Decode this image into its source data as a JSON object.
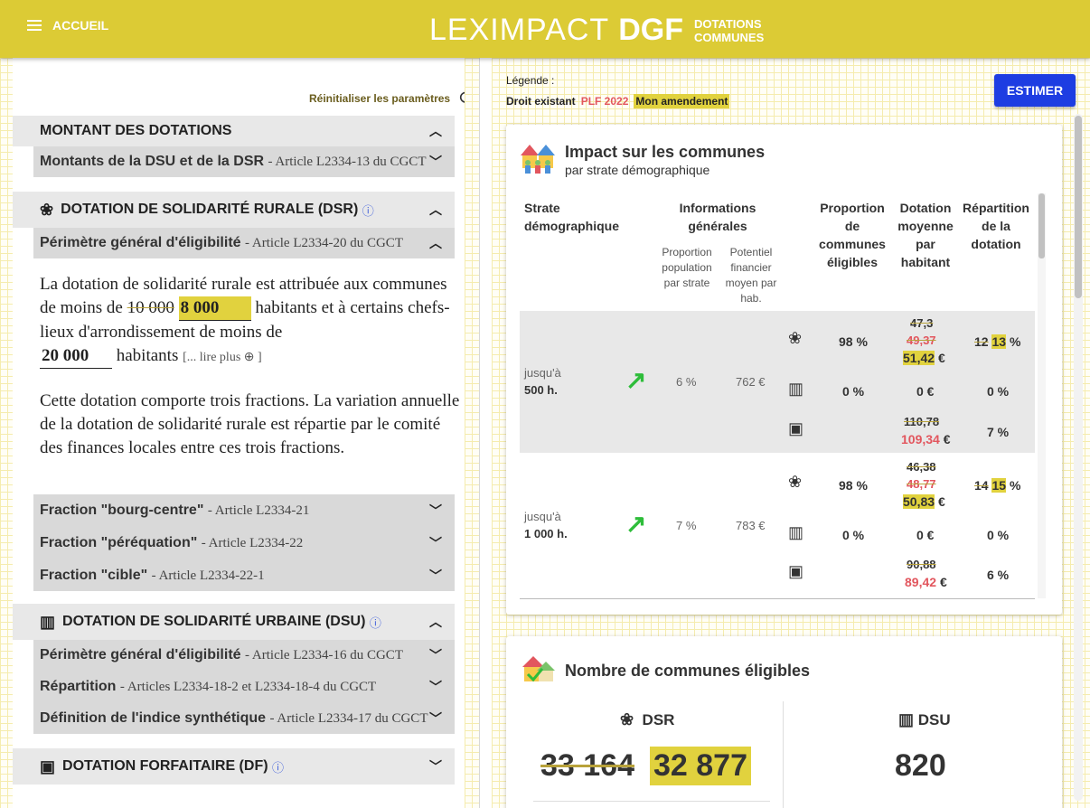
{
  "header": {
    "menu_label": "ACCUEIL",
    "logo_light": "LEXIMPACT",
    "logo_bold": "DGF",
    "logo_sub1": "DOTATIONS",
    "logo_sub2": "COMMUNES"
  },
  "left": {
    "reset_label": "Réinitialiser les paramètres",
    "sections": {
      "montant": {
        "title": "MONTANT DES DOTATIONS",
        "sub_title": "Montants de la DSU et de la DSR",
        "sub_article": "- Article L2334-13 du CGCT"
      },
      "dsr": {
        "title": "DOTATION DE SOLIDARITÉ RURALE (DSR)",
        "perimetre": "Périmètre général d'éligibilité",
        "perimetre_article": "- Article L2334-20 du CGCT",
        "p1_a": "La dotation de solidarité rurale est attribuée aux communes de moins de",
        "p1_old": "10 000",
        "p1_new": "8 000",
        "p1_b": "habitants et à certains chefs-lieux d'arrondissement de moins de",
        "p1_val2": "20 000",
        "p1_c": "habitants",
        "read_more": "[... lire plus ⊕ ]",
        "p2": "Cette dotation comporte trois fractions. La variation annuelle de la dotation de solidarité rurale est répartie par le comité des finances locales entre ces trois fractions.",
        "fractions": [
          {
            "label": "Fraction \"bourg-centre\"",
            "article": "- Article L2334-21"
          },
          {
            "label": "Fraction \"péréquation\"",
            "article": "- Article L2334-22"
          },
          {
            "label": "Fraction \"cible\"",
            "article": "- Article L2334-22-1"
          }
        ]
      },
      "dsu": {
        "title": "DOTATION DE SOLIDARITÉ URBAINE (DSU)",
        "items": [
          {
            "label": "Périmètre général d'éligibilité",
            "article": "- Article L2334-16 du CGCT"
          },
          {
            "label": "Répartition",
            "article": "- Articles L2334-18-2 et L2334-18-4 du CGCT"
          },
          {
            "label": "Définition de l'indice synthétique",
            "article": "- Article L2334-17 du CGCT"
          }
        ]
      },
      "df": {
        "title": "DOTATION FORFAITAIRE (DF)"
      }
    }
  },
  "right": {
    "legend": {
      "title": "Légende :",
      "droit": "Droit existant",
      "plf": "PLF 2022",
      "amendement": "Mon amendement"
    },
    "estimer_label": "ESTIMER",
    "impact": {
      "title": "Impact sur les communes",
      "subtitle": "par strate démographique",
      "headers": {
        "strate": "Strate démographique",
        "infos": "Informations générales",
        "prop_pop": "Proportion population par strate",
        "potentiel": "Potentiel financier moyen par hab.",
        "prop_elig": "Proportion de communes éligibles",
        "dot_moy": "Dotation moyenne par habitant",
        "repart": "Répartition de la dotation"
      },
      "rows": [
        {
          "label_a": "jusqu'à",
          "label_b": "500 h.",
          "prop_pop": "6 %",
          "potentiel": "762 €",
          "dsr": {
            "elig": "98 %",
            "old": "47,3",
            "plf": "49,37",
            "amd": "51,42",
            "unit": "€",
            "rep_old": "12",
            "rep_amd": "13",
            "rep_unit": "%"
          },
          "dsu": {
            "elig": "0 %",
            "dot": "0 €",
            "rep": "0 %"
          },
          "df": {
            "old": "110,78",
            "plf": "109,34",
            "unit": "€",
            "rep": "7 %"
          }
        },
        {
          "label_a": "jusqu'à",
          "label_b": "1 000 h.",
          "prop_pop": "7 %",
          "potentiel": "783 €",
          "dsr": {
            "elig": "98 %",
            "old": "46,38",
            "plf": "48,77",
            "amd": "50,83",
            "unit": "€",
            "rep_old": "14",
            "rep_amd": "15",
            "rep_unit": "%"
          },
          "dsu": {
            "elig": "0 %",
            "dot": "0 €",
            "rep": "0 %"
          },
          "df": {
            "old": "90,88",
            "plf": "89,42",
            "unit": "€",
            "rep": "6 %"
          }
        }
      ]
    },
    "eligibles": {
      "title": "Nombre de communes éligibles",
      "dsr_label": "DSR",
      "dsr_old": "33 164",
      "dsr_new": "32 877",
      "dsu_label": "DSU",
      "dsu_val": "820"
    }
  }
}
